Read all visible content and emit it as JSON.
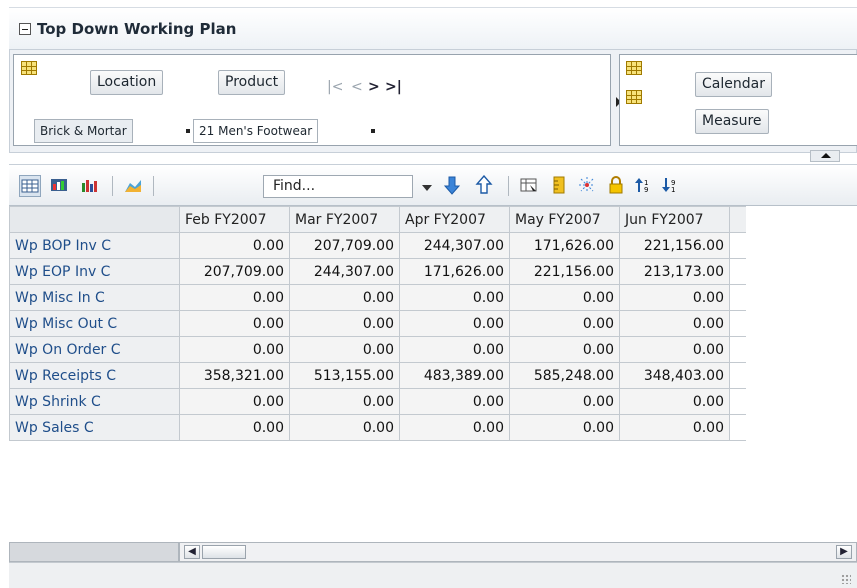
{
  "title": "Top Down Working Plan",
  "dimensions": {
    "left": {
      "buttons": [
        "Location",
        "Product"
      ],
      "members": [
        "Brick & Mortar",
        "21 Men's Footwear"
      ]
    },
    "right": {
      "buttons": [
        "Calendar",
        "Measure"
      ]
    },
    "nav_icons": [
      "first-icon",
      "previous-icon",
      "next-icon",
      "last-icon"
    ]
  },
  "toolbar": {
    "find_placeholder": "Find...",
    "icons": [
      "table-view-icon",
      "chart-table-icon",
      "bar-chart-icon",
      "area-chart-icon",
      "move-down-icon",
      "move-up-icon",
      "grid-select-icon",
      "ruler-icon",
      "spread-icon",
      "lock-icon",
      "sort-ascending-icon",
      "sort-descending-icon"
    ]
  },
  "grid": {
    "columns": [
      "Feb FY2007",
      "Mar FY2007",
      "Apr FY2007",
      "May FY2007",
      "Jun FY2007"
    ],
    "rows": [
      {
        "label": "Wp BOP Inv C",
        "values": [
          "0.00",
          "207,709.00",
          "244,307.00",
          "171,626.00",
          "221,156.00"
        ]
      },
      {
        "label": "Wp EOP Inv C",
        "values": [
          "207,709.00",
          "244,307.00",
          "171,626.00",
          "221,156.00",
          "213,173.00"
        ]
      },
      {
        "label": "Wp Misc In C",
        "values": [
          "0.00",
          "0.00",
          "0.00",
          "0.00",
          "0.00"
        ]
      },
      {
        "label": "Wp Misc Out C",
        "values": [
          "0.00",
          "0.00",
          "0.00",
          "0.00",
          "0.00"
        ]
      },
      {
        "label": "Wp On Order C",
        "values": [
          "0.00",
          "0.00",
          "0.00",
          "0.00",
          "0.00"
        ]
      },
      {
        "label": "Wp Receipts C",
        "values": [
          "358,321.00",
          "513,155.00",
          "483,389.00",
          "585,248.00",
          "348,403.00"
        ]
      },
      {
        "label": "Wp Shrink C",
        "values": [
          "0.00",
          "0.00",
          "0.00",
          "0.00",
          "0.00"
        ]
      },
      {
        "label": "Wp Sales C",
        "values": [
          "0.00",
          "0.00",
          "0.00",
          "0.00",
          "0.00"
        ]
      }
    ]
  }
}
